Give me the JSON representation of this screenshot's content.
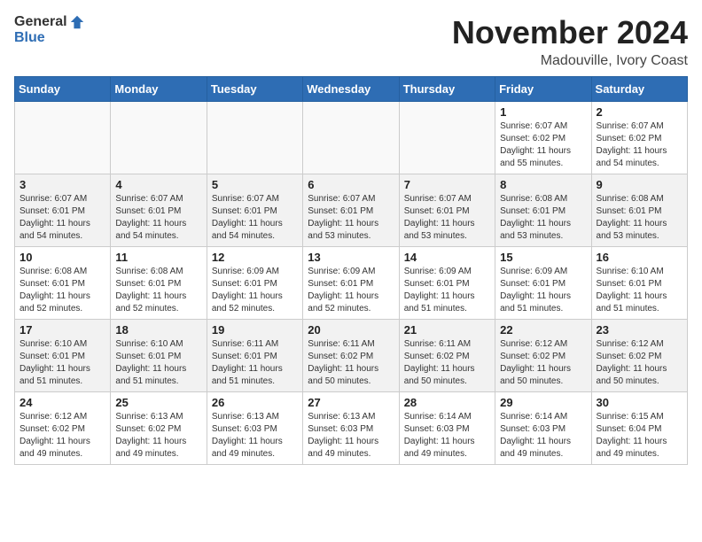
{
  "header": {
    "logo_general": "General",
    "logo_blue": "Blue",
    "month_title": "November 2024",
    "location": "Madouville, Ivory Coast"
  },
  "weekdays": [
    "Sunday",
    "Monday",
    "Tuesday",
    "Wednesday",
    "Thursday",
    "Friday",
    "Saturday"
  ],
  "weeks": [
    {
      "days": [
        {
          "date": "",
          "info": ""
        },
        {
          "date": "",
          "info": ""
        },
        {
          "date": "",
          "info": ""
        },
        {
          "date": "",
          "info": ""
        },
        {
          "date": "",
          "info": ""
        },
        {
          "date": "1",
          "info": "Sunrise: 6:07 AM\nSunset: 6:02 PM\nDaylight: 11 hours\nand 55 minutes."
        },
        {
          "date": "2",
          "info": "Sunrise: 6:07 AM\nSunset: 6:02 PM\nDaylight: 11 hours\nand 54 minutes."
        }
      ]
    },
    {
      "days": [
        {
          "date": "3",
          "info": "Sunrise: 6:07 AM\nSunset: 6:01 PM\nDaylight: 11 hours\nand 54 minutes."
        },
        {
          "date": "4",
          "info": "Sunrise: 6:07 AM\nSunset: 6:01 PM\nDaylight: 11 hours\nand 54 minutes."
        },
        {
          "date": "5",
          "info": "Sunrise: 6:07 AM\nSunset: 6:01 PM\nDaylight: 11 hours\nand 54 minutes."
        },
        {
          "date": "6",
          "info": "Sunrise: 6:07 AM\nSunset: 6:01 PM\nDaylight: 11 hours\nand 53 minutes."
        },
        {
          "date": "7",
          "info": "Sunrise: 6:07 AM\nSunset: 6:01 PM\nDaylight: 11 hours\nand 53 minutes."
        },
        {
          "date": "8",
          "info": "Sunrise: 6:08 AM\nSunset: 6:01 PM\nDaylight: 11 hours\nand 53 minutes."
        },
        {
          "date": "9",
          "info": "Sunrise: 6:08 AM\nSunset: 6:01 PM\nDaylight: 11 hours\nand 53 minutes."
        }
      ]
    },
    {
      "days": [
        {
          "date": "10",
          "info": "Sunrise: 6:08 AM\nSunset: 6:01 PM\nDaylight: 11 hours\nand 52 minutes."
        },
        {
          "date": "11",
          "info": "Sunrise: 6:08 AM\nSunset: 6:01 PM\nDaylight: 11 hours\nand 52 minutes."
        },
        {
          "date": "12",
          "info": "Sunrise: 6:09 AM\nSunset: 6:01 PM\nDaylight: 11 hours\nand 52 minutes."
        },
        {
          "date": "13",
          "info": "Sunrise: 6:09 AM\nSunset: 6:01 PM\nDaylight: 11 hours\nand 52 minutes."
        },
        {
          "date": "14",
          "info": "Sunrise: 6:09 AM\nSunset: 6:01 PM\nDaylight: 11 hours\nand 51 minutes."
        },
        {
          "date": "15",
          "info": "Sunrise: 6:09 AM\nSunset: 6:01 PM\nDaylight: 11 hours\nand 51 minutes."
        },
        {
          "date": "16",
          "info": "Sunrise: 6:10 AM\nSunset: 6:01 PM\nDaylight: 11 hours\nand 51 minutes."
        }
      ]
    },
    {
      "days": [
        {
          "date": "17",
          "info": "Sunrise: 6:10 AM\nSunset: 6:01 PM\nDaylight: 11 hours\nand 51 minutes."
        },
        {
          "date": "18",
          "info": "Sunrise: 6:10 AM\nSunset: 6:01 PM\nDaylight: 11 hours\nand 51 minutes."
        },
        {
          "date": "19",
          "info": "Sunrise: 6:11 AM\nSunset: 6:01 PM\nDaylight: 11 hours\nand 51 minutes."
        },
        {
          "date": "20",
          "info": "Sunrise: 6:11 AM\nSunset: 6:02 PM\nDaylight: 11 hours\nand 50 minutes."
        },
        {
          "date": "21",
          "info": "Sunrise: 6:11 AM\nSunset: 6:02 PM\nDaylight: 11 hours\nand 50 minutes."
        },
        {
          "date": "22",
          "info": "Sunrise: 6:12 AM\nSunset: 6:02 PM\nDaylight: 11 hours\nand 50 minutes."
        },
        {
          "date": "23",
          "info": "Sunrise: 6:12 AM\nSunset: 6:02 PM\nDaylight: 11 hours\nand 50 minutes."
        }
      ]
    },
    {
      "days": [
        {
          "date": "24",
          "info": "Sunrise: 6:12 AM\nSunset: 6:02 PM\nDaylight: 11 hours\nand 49 minutes."
        },
        {
          "date": "25",
          "info": "Sunrise: 6:13 AM\nSunset: 6:02 PM\nDaylight: 11 hours\nand 49 minutes."
        },
        {
          "date": "26",
          "info": "Sunrise: 6:13 AM\nSunset: 6:03 PM\nDaylight: 11 hours\nand 49 minutes."
        },
        {
          "date": "27",
          "info": "Sunrise: 6:13 AM\nSunset: 6:03 PM\nDaylight: 11 hours\nand 49 minutes."
        },
        {
          "date": "28",
          "info": "Sunrise: 6:14 AM\nSunset: 6:03 PM\nDaylight: 11 hours\nand 49 minutes."
        },
        {
          "date": "29",
          "info": "Sunrise: 6:14 AM\nSunset: 6:03 PM\nDaylight: 11 hours\nand 49 minutes."
        },
        {
          "date": "30",
          "info": "Sunrise: 6:15 AM\nSunset: 6:04 PM\nDaylight: 11 hours\nand 49 minutes."
        }
      ]
    }
  ]
}
